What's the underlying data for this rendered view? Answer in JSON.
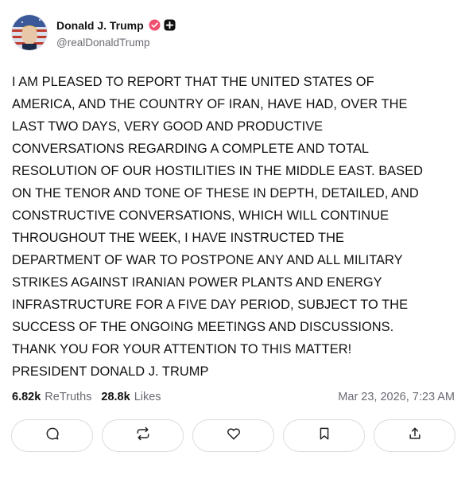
{
  "post": {
    "author": {
      "display_name": "Donald J. Trump",
      "handle": "@realDonaldTrump",
      "avatar_icon": "avatar-flag-portrait",
      "verified_icon": "verified-badge-icon",
      "plus_icon": "plus-badge-icon",
      "verified_color": "#f0506e"
    },
    "text": "I AM PLEASED TO REPORT THAT THE UNITED STATES OF\nAMERICA, AND THE COUNTRY OF IRAN, HAVE HAD, OVER THE\nLAST TWO DAYS, VERY GOOD AND PRODUCTIVE\nCONVERSATIONS REGARDING A COMPLETE AND TOTAL\nRESOLUTION OF OUR HOSTILITIES IN THE MIDDLE EAST. BASED\nON THE TENOR AND TONE OF THESE IN DEPTH, DETAILED, AND\nCONSTRUCTIVE CONVERSATIONS, WHICH WILL CONTINUE\nTHROUGHOUT THE WEEK, I HAVE INSTRUCTED THE\nDEPARTMENT OF WAR TO POSTPONE ANY AND ALL MILITARY\nSTRIKES AGAINST IRANIAN POWER PLANTS AND ENERGY\nINFRASTRUCTURE FOR A FIVE DAY PERIOD, SUBJECT TO THE\nSUCCESS OF THE ONGOING MEETINGS AND DISCUSSIONS.\nTHANK YOU FOR YOUR ATTENTION TO THIS MATTER!\nPRESIDENT DONALD J. TRUMP",
    "stats": {
      "retruths_count": "6.82k",
      "retruths_label": "ReTruths",
      "likes_count": "28.8k",
      "likes_label": "Likes"
    },
    "timestamp": "Mar 23, 2026, 7:23 AM",
    "actions": [
      {
        "name": "reply",
        "icon": "comment-icon"
      },
      {
        "name": "retruth",
        "icon": "repost-icon"
      },
      {
        "name": "like",
        "icon": "heart-icon"
      },
      {
        "name": "bookmark",
        "icon": "bookmark-icon"
      },
      {
        "name": "share",
        "icon": "share-icon"
      }
    ]
  }
}
